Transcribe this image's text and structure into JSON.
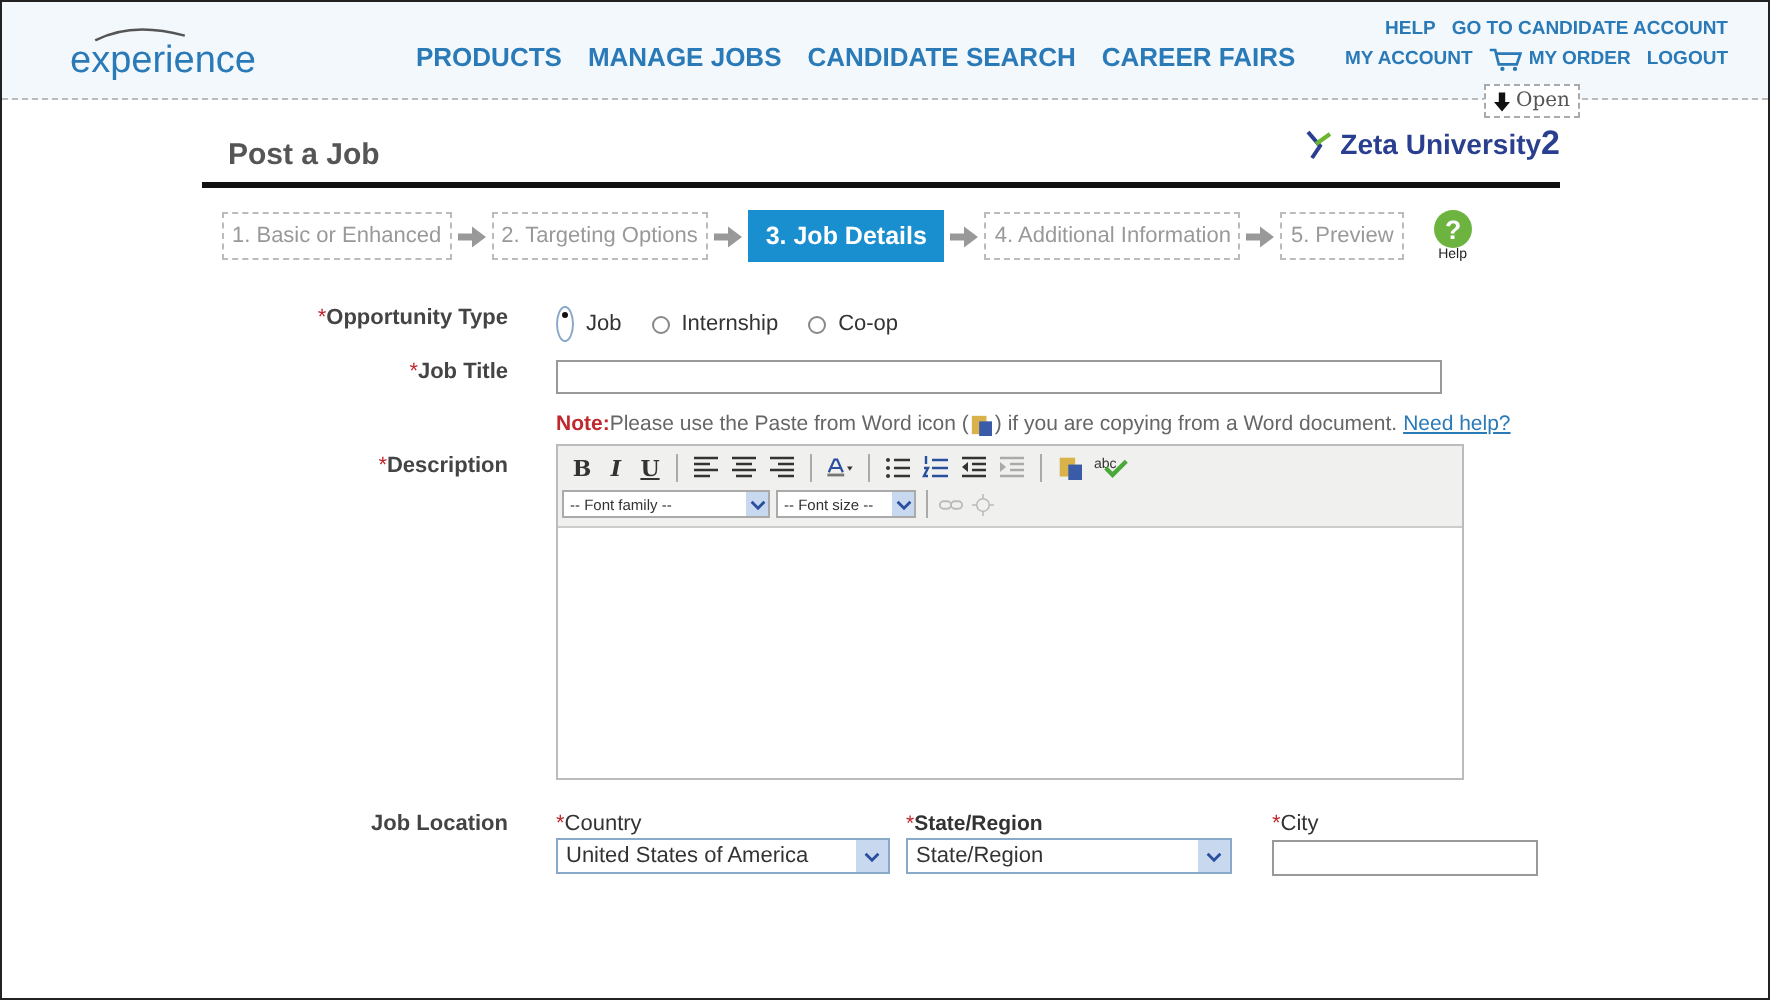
{
  "header": {
    "logo": "experience",
    "nav": [
      "PRODUCTS",
      "MANAGE JOBS",
      "CANDIDATE SEARCH",
      "CAREER FAIRS"
    ],
    "top_links": [
      "HELP",
      "GO TO CANDIDATE ACCOUNT"
    ],
    "account_links": [
      "MY ACCOUNT",
      "MY ORDER",
      "LOGOUT"
    ],
    "open_button": "Open"
  },
  "page_title": "Post a Job",
  "school_logo": "Zeta University",
  "school_logo_sup": "2",
  "steps": [
    {
      "label": "1. Basic or Enhanced",
      "selected": false
    },
    {
      "label": "2. Targeting Options",
      "selected": false
    },
    {
      "label": "3. Job Details",
      "selected": true
    },
    {
      "label": "4. Additional Information",
      "selected": false
    },
    {
      "label": "5. Preview",
      "selected": false
    }
  ],
  "help_label": "Help",
  "help_icon": "?",
  "required_mark": "*",
  "opportunity": {
    "label": "Opportunity Type",
    "required": true,
    "options": [
      {
        "label": "Job",
        "selected": true
      },
      {
        "label": "Internship",
        "selected": false
      },
      {
        "label": "Co-op",
        "selected": false
      }
    ]
  },
  "job_title": {
    "label": "Job Title",
    "required": true
  },
  "note": {
    "prefix": "Note:",
    "text_before": "Please use the Paste from Word icon (",
    "text_after": ") if you are copying from a Word document.",
    "link": "Need help?"
  },
  "description": {
    "label": "Description",
    "required": true,
    "font_family": "-- Font family --",
    "font_size": "-- Font size --",
    "spell_label": "abc",
    "format_buttons": [
      "B",
      "I",
      "U"
    ]
  },
  "location": {
    "label": "Job Location",
    "fields": [
      {
        "label": "Country",
        "kind": "select",
        "value": "United States of America",
        "required": true
      },
      {
        "label": "State/Region",
        "kind": "select",
        "value": "State/Region",
        "required": true
      },
      {
        "label": "City",
        "kind": "text",
        "required": true
      }
    ]
  }
}
